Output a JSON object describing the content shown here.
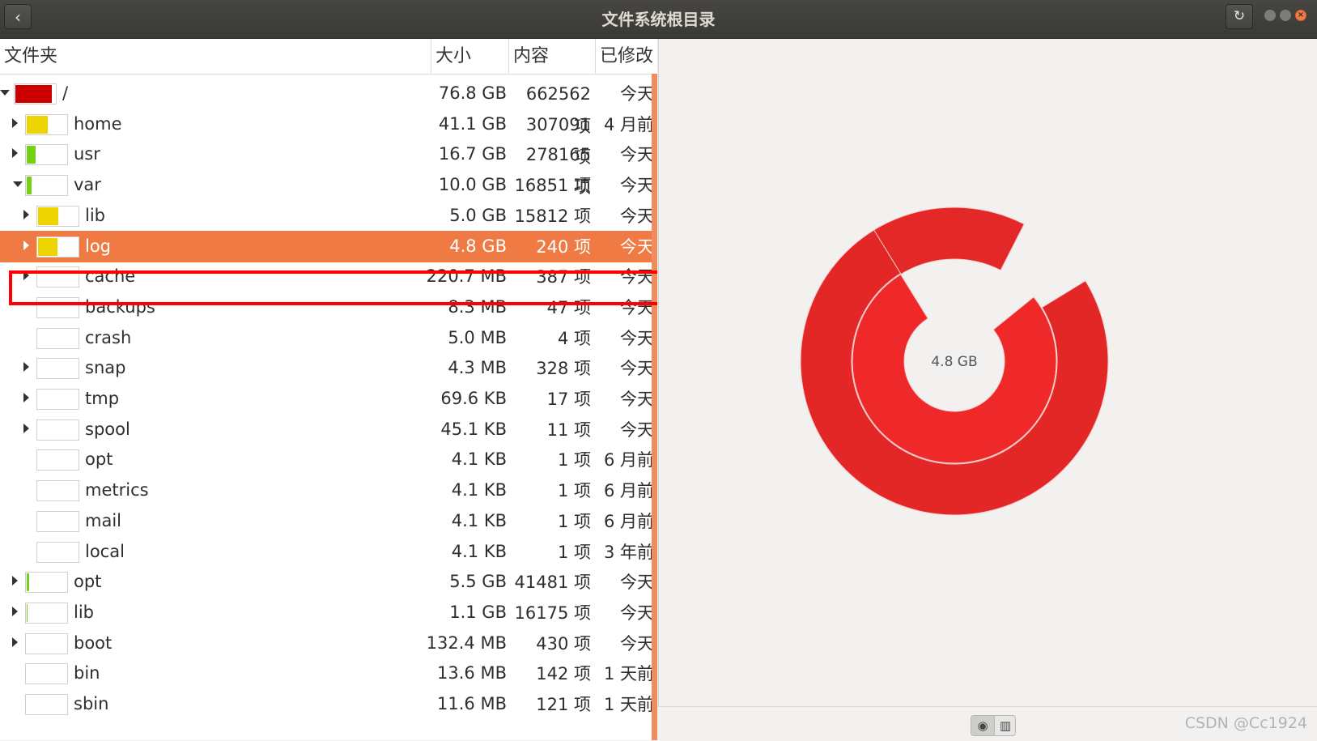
{
  "window": {
    "title": "文件系统根目录"
  },
  "columns": {
    "name": "文件夹",
    "size": "大小",
    "contents": "内容",
    "modified": "已修改"
  },
  "rows": [
    {
      "name": "/",
      "size": "76.8 GB",
      "contents": "662562 项",
      "modified": "今天",
      "level": 0,
      "expander": "down",
      "usage": 0.92,
      "bar_color": "#cc0000"
    },
    {
      "name": "home",
      "size": "41.1 GB",
      "contents": "307091 项",
      "modified": "4 月前",
      "level": 1,
      "expander": "right",
      "usage": 0.54,
      "bar_color": "#edd400"
    },
    {
      "name": "usr",
      "size": "16.7 GB",
      "contents": "278165 项",
      "modified": "今天",
      "level": 1,
      "expander": "right",
      "usage": 0.22,
      "bar_color": "#73d216"
    },
    {
      "name": "var",
      "size": "10.0 GB",
      "contents": "16851 项",
      "modified": "今天",
      "level": 1,
      "expander": "down",
      "usage": 0.13,
      "bar_color": "#73d216"
    },
    {
      "name": "lib",
      "size": "5.0 GB",
      "contents": "15812 项",
      "modified": "今天",
      "level": 2,
      "expander": "right",
      "usage": 0.5,
      "bar_color": "#edd400"
    },
    {
      "name": "log",
      "size": "4.8 GB",
      "contents": "240 项",
      "modified": "今天",
      "level": 2,
      "expander": "right",
      "usage": 0.48,
      "bar_color": "#edd400",
      "selected": true
    },
    {
      "name": "cache",
      "size": "220.7 MB",
      "contents": "387 项",
      "modified": "今天",
      "level": 2,
      "expander": "right",
      "usage": 0,
      "bar_color": "#edd400"
    },
    {
      "name": "backups",
      "size": "8.3 MB",
      "contents": "47 项",
      "modified": "今天",
      "level": 2,
      "expander": "none",
      "usage": 0,
      "bar_color": "#edd400"
    },
    {
      "name": "crash",
      "size": "5.0 MB",
      "contents": "4 项",
      "modified": "今天",
      "level": 2,
      "expander": "none",
      "usage": 0,
      "bar_color": "#edd400"
    },
    {
      "name": "snap",
      "size": "4.3 MB",
      "contents": "328 项",
      "modified": "今天",
      "level": 2,
      "expander": "right",
      "usage": 0,
      "bar_color": "#edd400"
    },
    {
      "name": "tmp",
      "size": "69.6 KB",
      "contents": "17 项",
      "modified": "今天",
      "level": 2,
      "expander": "right",
      "usage": 0,
      "bar_color": "#edd400"
    },
    {
      "name": "spool",
      "size": "45.1 KB",
      "contents": "11 项",
      "modified": "今天",
      "level": 2,
      "expander": "right",
      "usage": 0,
      "bar_color": "#edd400"
    },
    {
      "name": "opt",
      "size": "4.1 KB",
      "contents": "1 项",
      "modified": "6 月前",
      "level": 2,
      "expander": "none",
      "usage": 0,
      "bar_color": "#edd400"
    },
    {
      "name": "metrics",
      "size": "4.1 KB",
      "contents": "1 项",
      "modified": "6 月前",
      "level": 2,
      "expander": "none",
      "usage": 0,
      "bar_color": "#edd400"
    },
    {
      "name": "mail",
      "size": "4.1 KB",
      "contents": "1 项",
      "modified": "6 月前",
      "level": 2,
      "expander": "none",
      "usage": 0,
      "bar_color": "#edd400"
    },
    {
      "name": "local",
      "size": "4.1 KB",
      "contents": "1 项",
      "modified": "3 年前",
      "level": 2,
      "expander": "none",
      "usage": 0,
      "bar_color": "#edd400"
    },
    {
      "name": "opt",
      "size": "5.5 GB",
      "contents": "41481 项",
      "modified": "今天",
      "level": 1,
      "expander": "right",
      "usage": 0.07,
      "bar_color": "#73d216"
    },
    {
      "name": "lib",
      "size": "1.1 GB",
      "contents": "16175 项",
      "modified": "今天",
      "level": 1,
      "expander": "right",
      "usage": 0.01,
      "bar_color": "#73d216"
    },
    {
      "name": "boot",
      "size": "132.4 MB",
      "contents": "430 项",
      "modified": "今天",
      "level": 1,
      "expander": "right",
      "usage": 0,
      "bar_color": "#73d216"
    },
    {
      "name": "bin",
      "size": "13.6 MB",
      "contents": "142 项",
      "modified": "1 天前",
      "level": 1,
      "expander": "none",
      "usage": 0,
      "bar_color": "#73d216"
    },
    {
      "name": "sbin",
      "size": "11.6 MB",
      "contents": "121 项",
      "modified": "1 天前",
      "level": 1,
      "expander": "none",
      "usage": 0,
      "bar_color": "#73d216"
    }
  ],
  "chart": {
    "center_label": "4.8 GB",
    "rings": [
      {
        "name": "log",
        "fraction": 0.77,
        "color": "#ef2929"
      },
      {
        "name": "log",
        "fraction": 0.825,
        "color": "#e42727"
      },
      {
        "name": "log",
        "fraction": 0.75,
        "color": "#e32626"
      }
    ]
  },
  "bottom_bar": {
    "watermark": "CSDN @Cc1924"
  },
  "icons": {
    "back": "chevron-left-icon",
    "refresh": "refresh-icon",
    "ring_view": "ring-chart-icon",
    "tree_view": "treemap-icon"
  }
}
